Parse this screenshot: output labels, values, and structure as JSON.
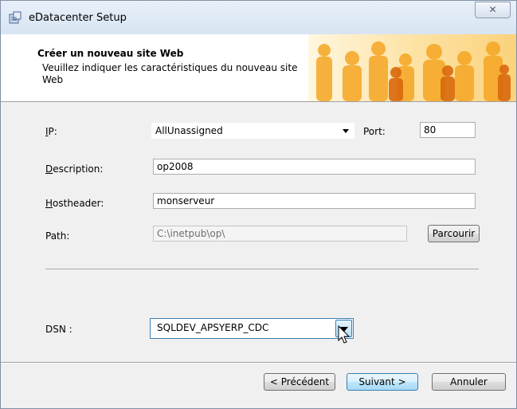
{
  "window": {
    "title": "eDatacenter Setup",
    "close_glyph": "✕"
  },
  "header": {
    "title": "Créer un nouveau site Web",
    "subtitle": "Veuillez indiquer les caractéristiques du nouveau site Web"
  },
  "form": {
    "ip_label_u": "I",
    "ip_label_rest": "P:",
    "ip_value": "AllUnassigned",
    "port_label": "Port:",
    "port_value": "80",
    "description_label_u": "D",
    "description_label_rest": "escription:",
    "description_value": "op2008",
    "hostheader_label_u": "H",
    "hostheader_label_rest": "ostheader:",
    "hostheader_value": "monserveur",
    "path_label": "Path:",
    "path_value": "C:\\inetpub\\op\\",
    "browse_label": "Parcourir",
    "dsn_label": "DSN :",
    "dsn_value": "SQLDEV_APSYERP_CDC"
  },
  "footer": {
    "back_label": "< Précédent",
    "next_label": "Suivant >",
    "cancel_label": "Annuler"
  },
  "icons": {
    "app": "setup-box-icon",
    "close": "close-icon",
    "dropdown": "chevron-down-icon",
    "cursor": "mouse-pointer-icon"
  },
  "colors": {
    "accent": "#3c7fb1",
    "banner_orange": "#f5a623",
    "titlebar": "#dce7f3"
  }
}
